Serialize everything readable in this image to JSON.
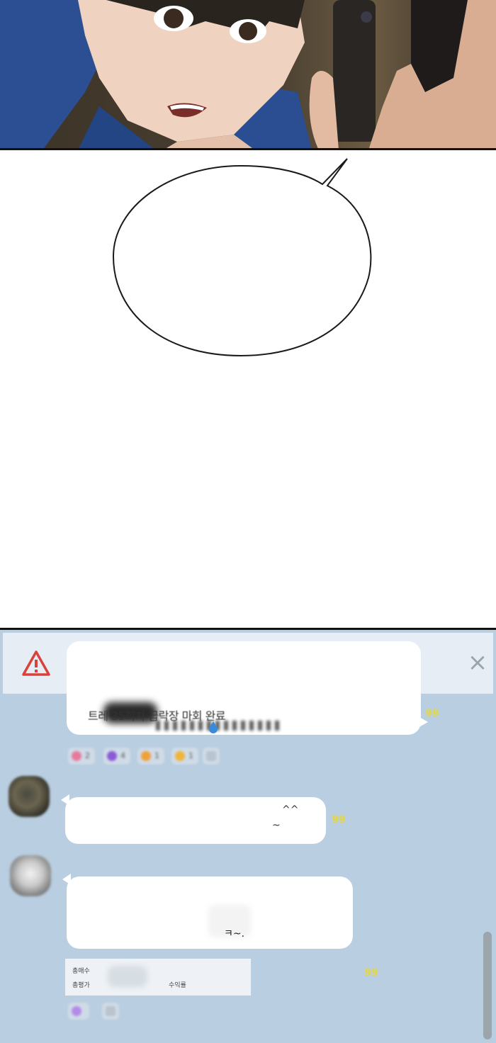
{
  "notice": {
    "warning_icon": "warning-triangle-icon",
    "close_icon": "close-x-icon",
    "close_glyph": "×"
  },
  "messages": [
    {
      "text_visible": "트레           35회차 급락장 마회 완료",
      "read_count": "99",
      "reactions": [
        "2",
        "4",
        "1",
        "1",
        ""
      ]
    },
    {
      "line1": "^^",
      "line2": "~",
      "read_count": "99"
    },
    {
      "line1": "ㅋ~.",
      "stat_labels": [
        "총매수",
        "총평가",
        "수익률"
      ],
      "read_count": "99"
    }
  ],
  "colors": {
    "chat_background": "#b9cee0",
    "bubble": "#ffffff",
    "warning_red": "#d9423a",
    "read_count": "#e6d83a"
  }
}
